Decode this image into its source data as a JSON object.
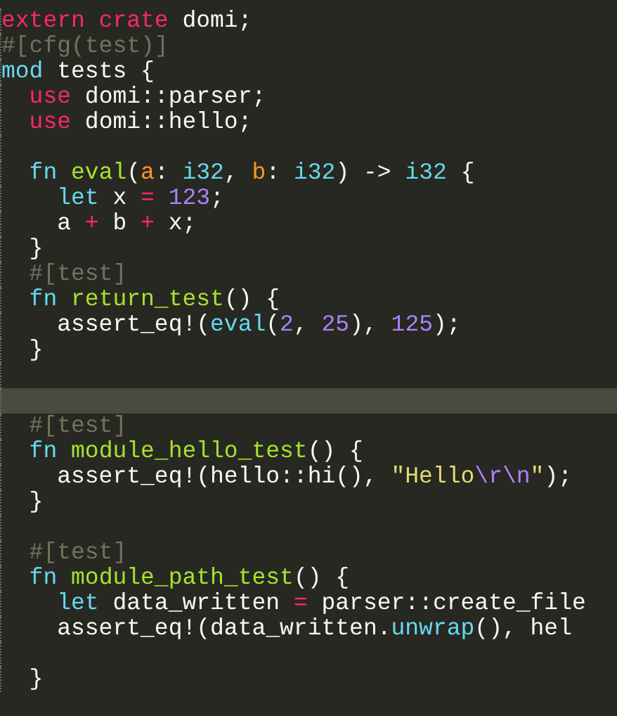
{
  "editor": {
    "lines": [
      {
        "kind": "code",
        "current": false,
        "tokens": [
          {
            "text": "extern crate",
            "kind": "keyword"
          },
          {
            "text": " domi;",
            "kind": "plain"
          }
        ]
      },
      {
        "kind": "code",
        "current": false,
        "tokens": [
          {
            "text": "#[cfg(test)]",
            "kind": "comment"
          }
        ]
      },
      {
        "kind": "code",
        "current": false,
        "tokens": [
          {
            "text": "mod",
            "kind": "storage"
          },
          {
            "text": " tests {",
            "kind": "plain"
          }
        ]
      },
      {
        "kind": "code",
        "current": false,
        "tokens": [
          {
            "text": "  use",
            "kind": "keyword"
          },
          {
            "text": " domi::parser;",
            "kind": "plain"
          }
        ]
      },
      {
        "kind": "code",
        "current": false,
        "tokens": [
          {
            "text": "  use",
            "kind": "keyword"
          },
          {
            "text": " domi::hello;",
            "kind": "plain"
          }
        ]
      },
      {
        "kind": "blank",
        "current": false
      },
      {
        "kind": "code",
        "current": false,
        "tokens": [
          {
            "text": "  fn",
            "kind": "storage"
          },
          {
            "text": " eval",
            "kind": "name"
          },
          {
            "text": "(",
            "kind": "plain"
          },
          {
            "text": "a",
            "kind": "param"
          },
          {
            "text": ": ",
            "kind": "plain"
          },
          {
            "text": "i32",
            "kind": "storage"
          },
          {
            "text": ", ",
            "kind": "plain"
          },
          {
            "text": "b",
            "kind": "param"
          },
          {
            "text": ": ",
            "kind": "plain"
          },
          {
            "text": "i32",
            "kind": "storage"
          },
          {
            "text": ") ->",
            "kind": "plain"
          },
          {
            "text": " i32",
            "kind": "storage"
          },
          {
            "text": " {",
            "kind": "plain"
          }
        ]
      },
      {
        "kind": "code",
        "current": false,
        "tokens": [
          {
            "text": "    let",
            "kind": "storage"
          },
          {
            "text": " x ",
            "kind": "plain"
          },
          {
            "text": "=",
            "kind": "keyword"
          },
          {
            "text": " 123",
            "kind": "number"
          },
          {
            "text": ";",
            "kind": "plain"
          }
        ]
      },
      {
        "kind": "code",
        "current": false,
        "tokens": [
          {
            "text": "    a ",
            "kind": "plain"
          },
          {
            "text": "+",
            "kind": "keyword"
          },
          {
            "text": " b ",
            "kind": "plain"
          },
          {
            "text": "+",
            "kind": "keyword"
          },
          {
            "text": " x;",
            "kind": "plain"
          }
        ]
      },
      {
        "kind": "code",
        "current": false,
        "tokens": [
          {
            "text": "  }",
            "kind": "plain"
          }
        ]
      },
      {
        "kind": "code",
        "current": false,
        "tokens": [
          {
            "text": "  #[test]",
            "kind": "comment"
          }
        ]
      },
      {
        "kind": "code",
        "current": false,
        "tokens": [
          {
            "text": "  fn",
            "kind": "storage"
          },
          {
            "text": " return_test",
            "kind": "name"
          },
          {
            "text": "() {",
            "kind": "plain"
          }
        ]
      },
      {
        "kind": "code",
        "current": false,
        "tokens": [
          {
            "text": "    assert_eq!(",
            "kind": "plain"
          },
          {
            "text": "eval",
            "kind": "storage"
          },
          {
            "text": "(",
            "kind": "plain"
          },
          {
            "text": "2",
            "kind": "number"
          },
          {
            "text": ", ",
            "kind": "plain"
          },
          {
            "text": "25",
            "kind": "number"
          },
          {
            "text": "), ",
            "kind": "plain"
          },
          {
            "text": "125",
            "kind": "number"
          },
          {
            "text": ");",
            "kind": "plain"
          }
        ]
      },
      {
        "kind": "code",
        "current": false,
        "tokens": [
          {
            "text": "  }",
            "kind": "plain"
          }
        ]
      },
      {
        "kind": "blank",
        "current": false
      },
      {
        "kind": "blank",
        "current": true
      },
      {
        "kind": "code",
        "current": false,
        "tokens": [
          {
            "text": "  #[test]",
            "kind": "comment"
          }
        ]
      },
      {
        "kind": "code",
        "current": false,
        "tokens": [
          {
            "text": "  fn",
            "kind": "storage"
          },
          {
            "text": " module_hello_test",
            "kind": "name"
          },
          {
            "text": "() {",
            "kind": "plain"
          }
        ]
      },
      {
        "kind": "code",
        "current": false,
        "tokens": [
          {
            "text": "    assert_eq!(hello::hi(), ",
            "kind": "plain"
          },
          {
            "text": "\"Hello",
            "kind": "string"
          },
          {
            "text": "\\r\\n",
            "kind": "number"
          },
          {
            "text": "\"",
            "kind": "string"
          },
          {
            "text": ");",
            "kind": "plain"
          }
        ]
      },
      {
        "kind": "code",
        "current": false,
        "tokens": [
          {
            "text": "  }",
            "kind": "plain"
          }
        ]
      },
      {
        "kind": "blank",
        "current": false
      },
      {
        "kind": "code",
        "current": false,
        "tokens": [
          {
            "text": "  #[test]",
            "kind": "comment"
          }
        ]
      },
      {
        "kind": "code",
        "current": false,
        "tokens": [
          {
            "text": "  fn",
            "kind": "storage"
          },
          {
            "text": " module_path_test",
            "kind": "name"
          },
          {
            "text": "() {",
            "kind": "plain"
          }
        ]
      },
      {
        "kind": "code",
        "current": false,
        "tokens": [
          {
            "text": "    let",
            "kind": "storage"
          },
          {
            "text": " data_written ",
            "kind": "plain"
          },
          {
            "text": "=",
            "kind": "keyword"
          },
          {
            "text": " parser::create_file",
            "kind": "plain"
          }
        ]
      },
      {
        "kind": "code",
        "current": false,
        "tokens": [
          {
            "text": "    assert_eq!(data_written.",
            "kind": "plain"
          },
          {
            "text": "unwrap",
            "kind": "storage"
          },
          {
            "text": "(), hel",
            "kind": "plain"
          }
        ]
      },
      {
        "kind": "blank",
        "current": false
      },
      {
        "kind": "code",
        "current": false,
        "tokens": [
          {
            "text": "  }",
            "kind": "plain"
          }
        ]
      }
    ]
  }
}
